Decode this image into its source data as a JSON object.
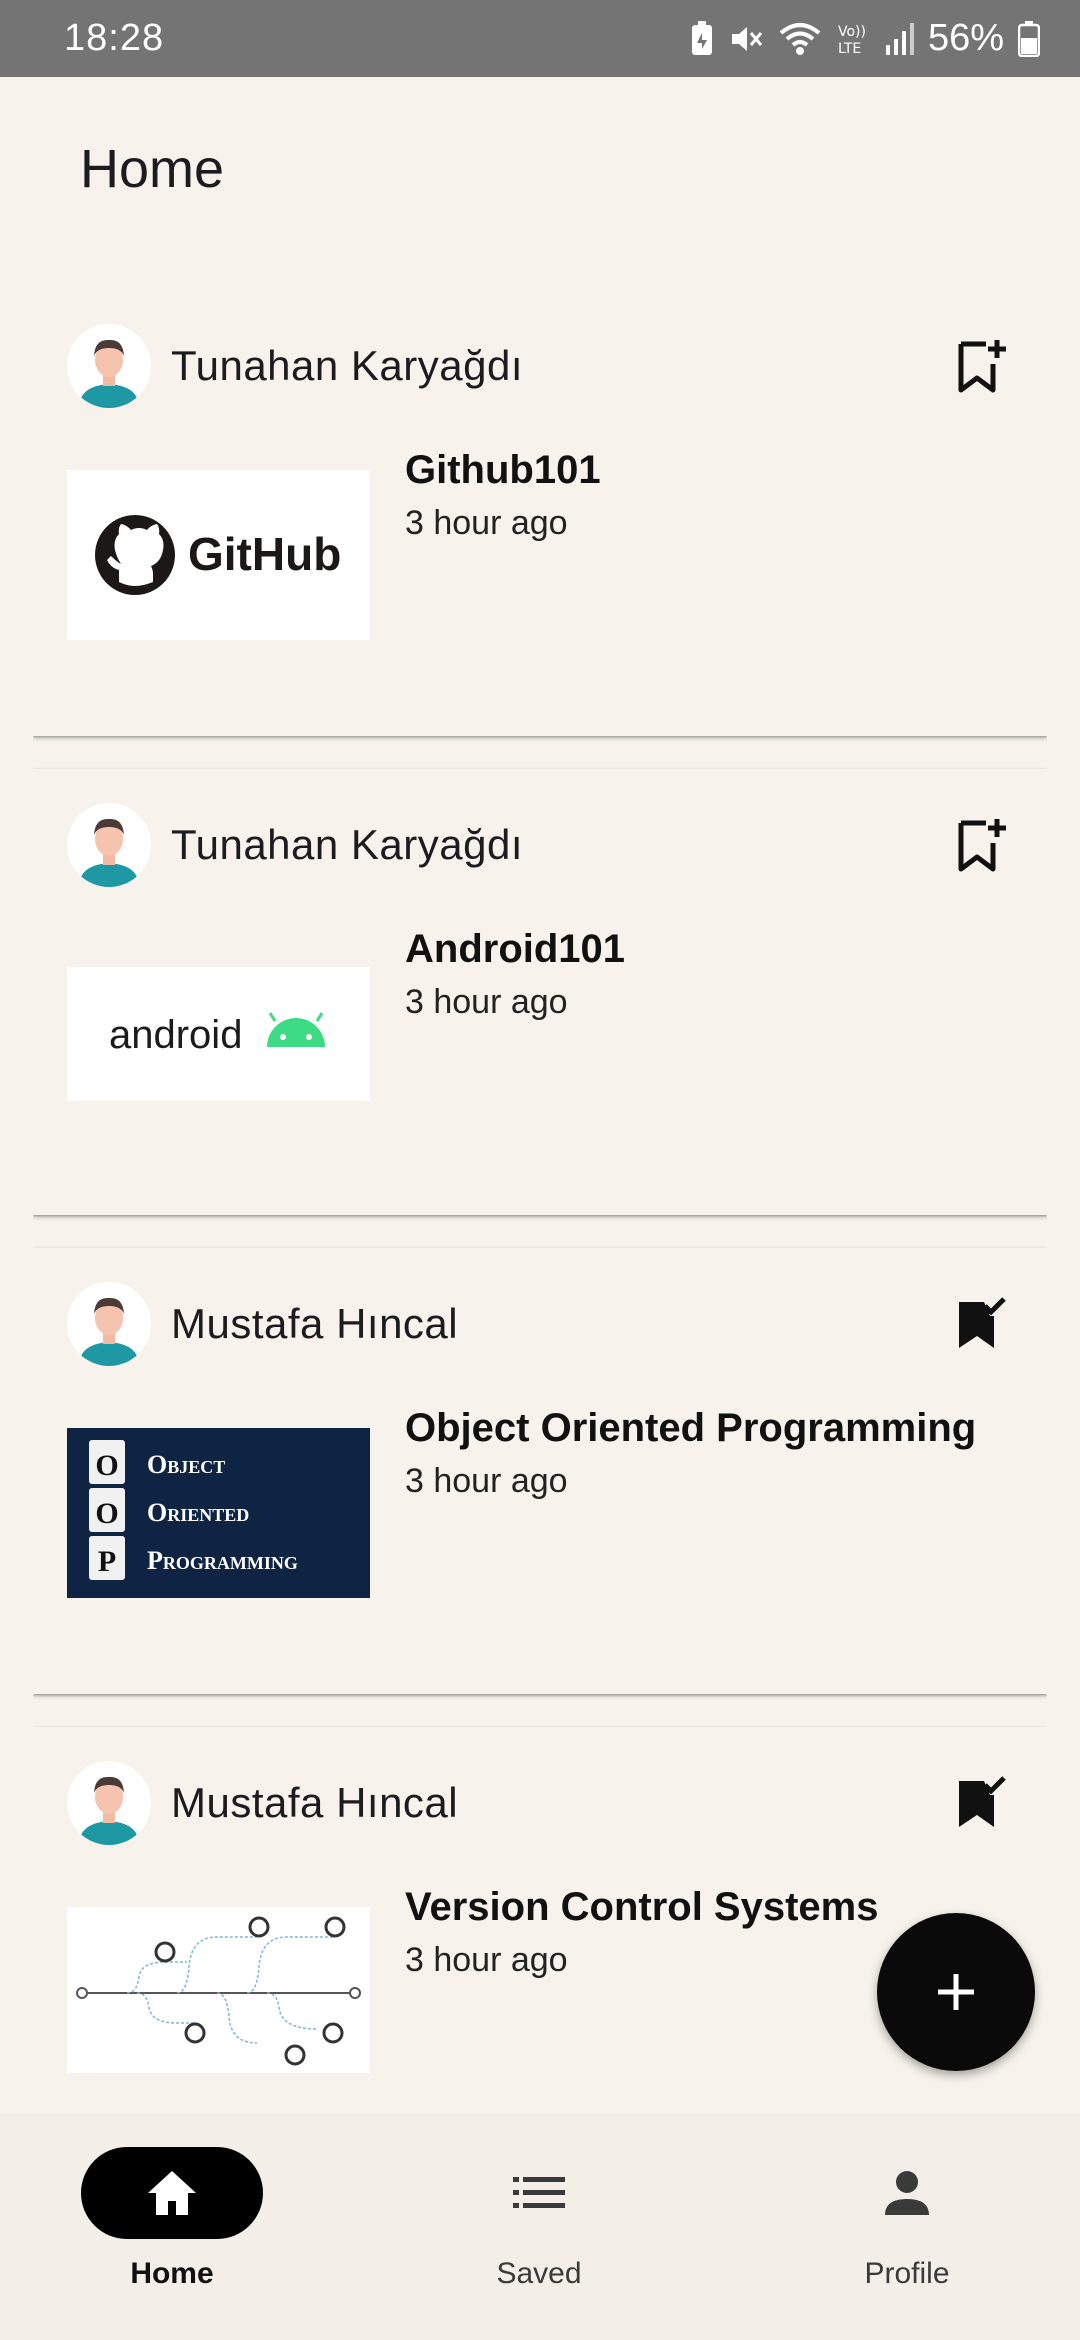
{
  "status_bar": {
    "time": "18:28",
    "battery": "56%",
    "icons": [
      "battery-saver-icon",
      "mute-icon",
      "wifi-icon",
      "volte-icon",
      "signal-icon",
      "battery-icon"
    ]
  },
  "header": {
    "title": "Home"
  },
  "posts": [
    {
      "author": "Tunahan Karyağdı",
      "title": "Github101",
      "time": "3 hour ago",
      "saved": false,
      "thumb_logo_text": "GitHub"
    },
    {
      "author": "Tunahan Karyağdı",
      "title": "Android101",
      "time": "3 hour ago",
      "saved": false,
      "thumb_logo_text": "android"
    },
    {
      "author": "Mustafa Hıncal",
      "title": "Object Oriented Programming",
      "time": "3 hour ago",
      "saved": true,
      "thumb_logo_lines": [
        {
          "letter": "O",
          "word": "Object"
        },
        {
          "letter": "O",
          "word": "Oriented"
        },
        {
          "letter": "P",
          "word": "Programming"
        }
      ]
    },
    {
      "author": "Mustafa Hıncal",
      "title": "Version Control Systems",
      "time": "3 hour ago",
      "saved": true
    }
  ],
  "fab": {
    "icon": "plus-icon"
  },
  "bottom_nav": {
    "items": [
      {
        "label": "Home",
        "icon": "home-icon",
        "active": true
      },
      {
        "label": "Saved",
        "icon": "list-icon",
        "active": false
      },
      {
        "label": "Profile",
        "icon": "person-icon",
        "active": false
      }
    ]
  },
  "colors": {
    "background": "#f7f3ec",
    "status_bar": "#747474",
    "nav_active": "#000000",
    "fab": "#0a0a0a",
    "oop_thumb": "#0f2342",
    "android_green": "#3ddc84"
  }
}
